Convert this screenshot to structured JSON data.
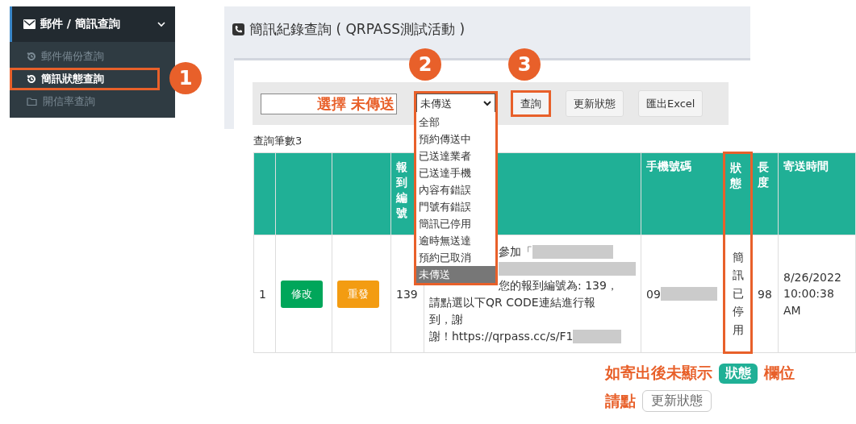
{
  "sidebar": {
    "header": {
      "label": "郵件 / 簡訊查詢",
      "expanded": true
    },
    "items": [
      {
        "label": "郵件備份查詢",
        "selected": false,
        "highlighted": false
      },
      {
        "label": "簡訊狀態查詢",
        "selected": true,
        "highlighted": true
      },
      {
        "label": "開信率查詢",
        "selected": false,
        "highlighted": false
      }
    ]
  },
  "panel": {
    "title": "簡訊紀錄查詢 ( QRPASS測試活動 )",
    "filter_field": {
      "value": "選擇 未傳送"
    },
    "status_dropdown": {
      "value": "未傳送",
      "highlighted": true,
      "options": [
        {
          "label": "全部",
          "selected": false
        },
        {
          "label": "預約傳送中",
          "selected": false
        },
        {
          "label": "已送達業者",
          "selected": false
        },
        {
          "label": "已送達手機",
          "selected": false
        },
        {
          "label": "內容有錯誤",
          "selected": false
        },
        {
          "label": "門號有錯誤",
          "selected": false
        },
        {
          "label": "簡訊已停用",
          "selected": false
        },
        {
          "label": "逾時無送達",
          "selected": false
        },
        {
          "label": "預約已取消",
          "selected": false
        },
        {
          "label": "未傳送",
          "selected": true
        }
      ]
    },
    "buttons": [
      {
        "label": "查詢",
        "highlighted": true
      },
      {
        "label": "更新狀態",
        "highlighted": false
      },
      {
        "label": "匯出Excel",
        "highlighted": false
      }
    ]
  },
  "result_count": "查詢筆數3",
  "table": {
    "columns": [
      {
        "highlighted": false
      },
      {
        "highlighted": false
      },
      {
        "highlighted": false
      },
      {
        "label": "報到編號",
        "highlighted": false
      },
      {
        "highlighted": false
      },
      {
        "label": "手機號碼",
        "highlighted": false
      },
      {
        "label": "狀態",
        "highlighted": true
      },
      {
        "label": "長度",
        "highlighted": false
      },
      {
        "label": "寄送時間",
        "highlighted": false
      }
    ],
    "rows": [
      {
        "index": "1",
        "edit_button": "修改",
        "resend_button": "重發",
        "checkin_no": "139",
        "message": [
          {
            "text": "參加「",
            "redacted": true
          },
          {
            "redacted": true
          },
          {
            "text": "您的報到編號為: 139，",
            "redacted": false
          },
          {
            "text": "請點選以下QR CODE連結進行報",
            "redacted": false
          },
          {
            "text": "到，謝",
            "redacted": false
          },
          {
            "text": "謝！https://qrpass.cc/s/F1",
            "redacted": true
          }
        ],
        "phone": "09",
        "status": "簡訊已停用",
        "length": "98",
        "sent_time": "8/26/2022 10:00:38 AM"
      }
    ]
  },
  "step_markers": [
    "1",
    "2",
    "3"
  ],
  "note": {
    "line_1": {
      "before": "如寄出後未顯示",
      "badge": "狀態",
      "after": "欄位"
    },
    "line_2": {
      "before": "請點",
      "button": "更新狀態"
    }
  }
}
